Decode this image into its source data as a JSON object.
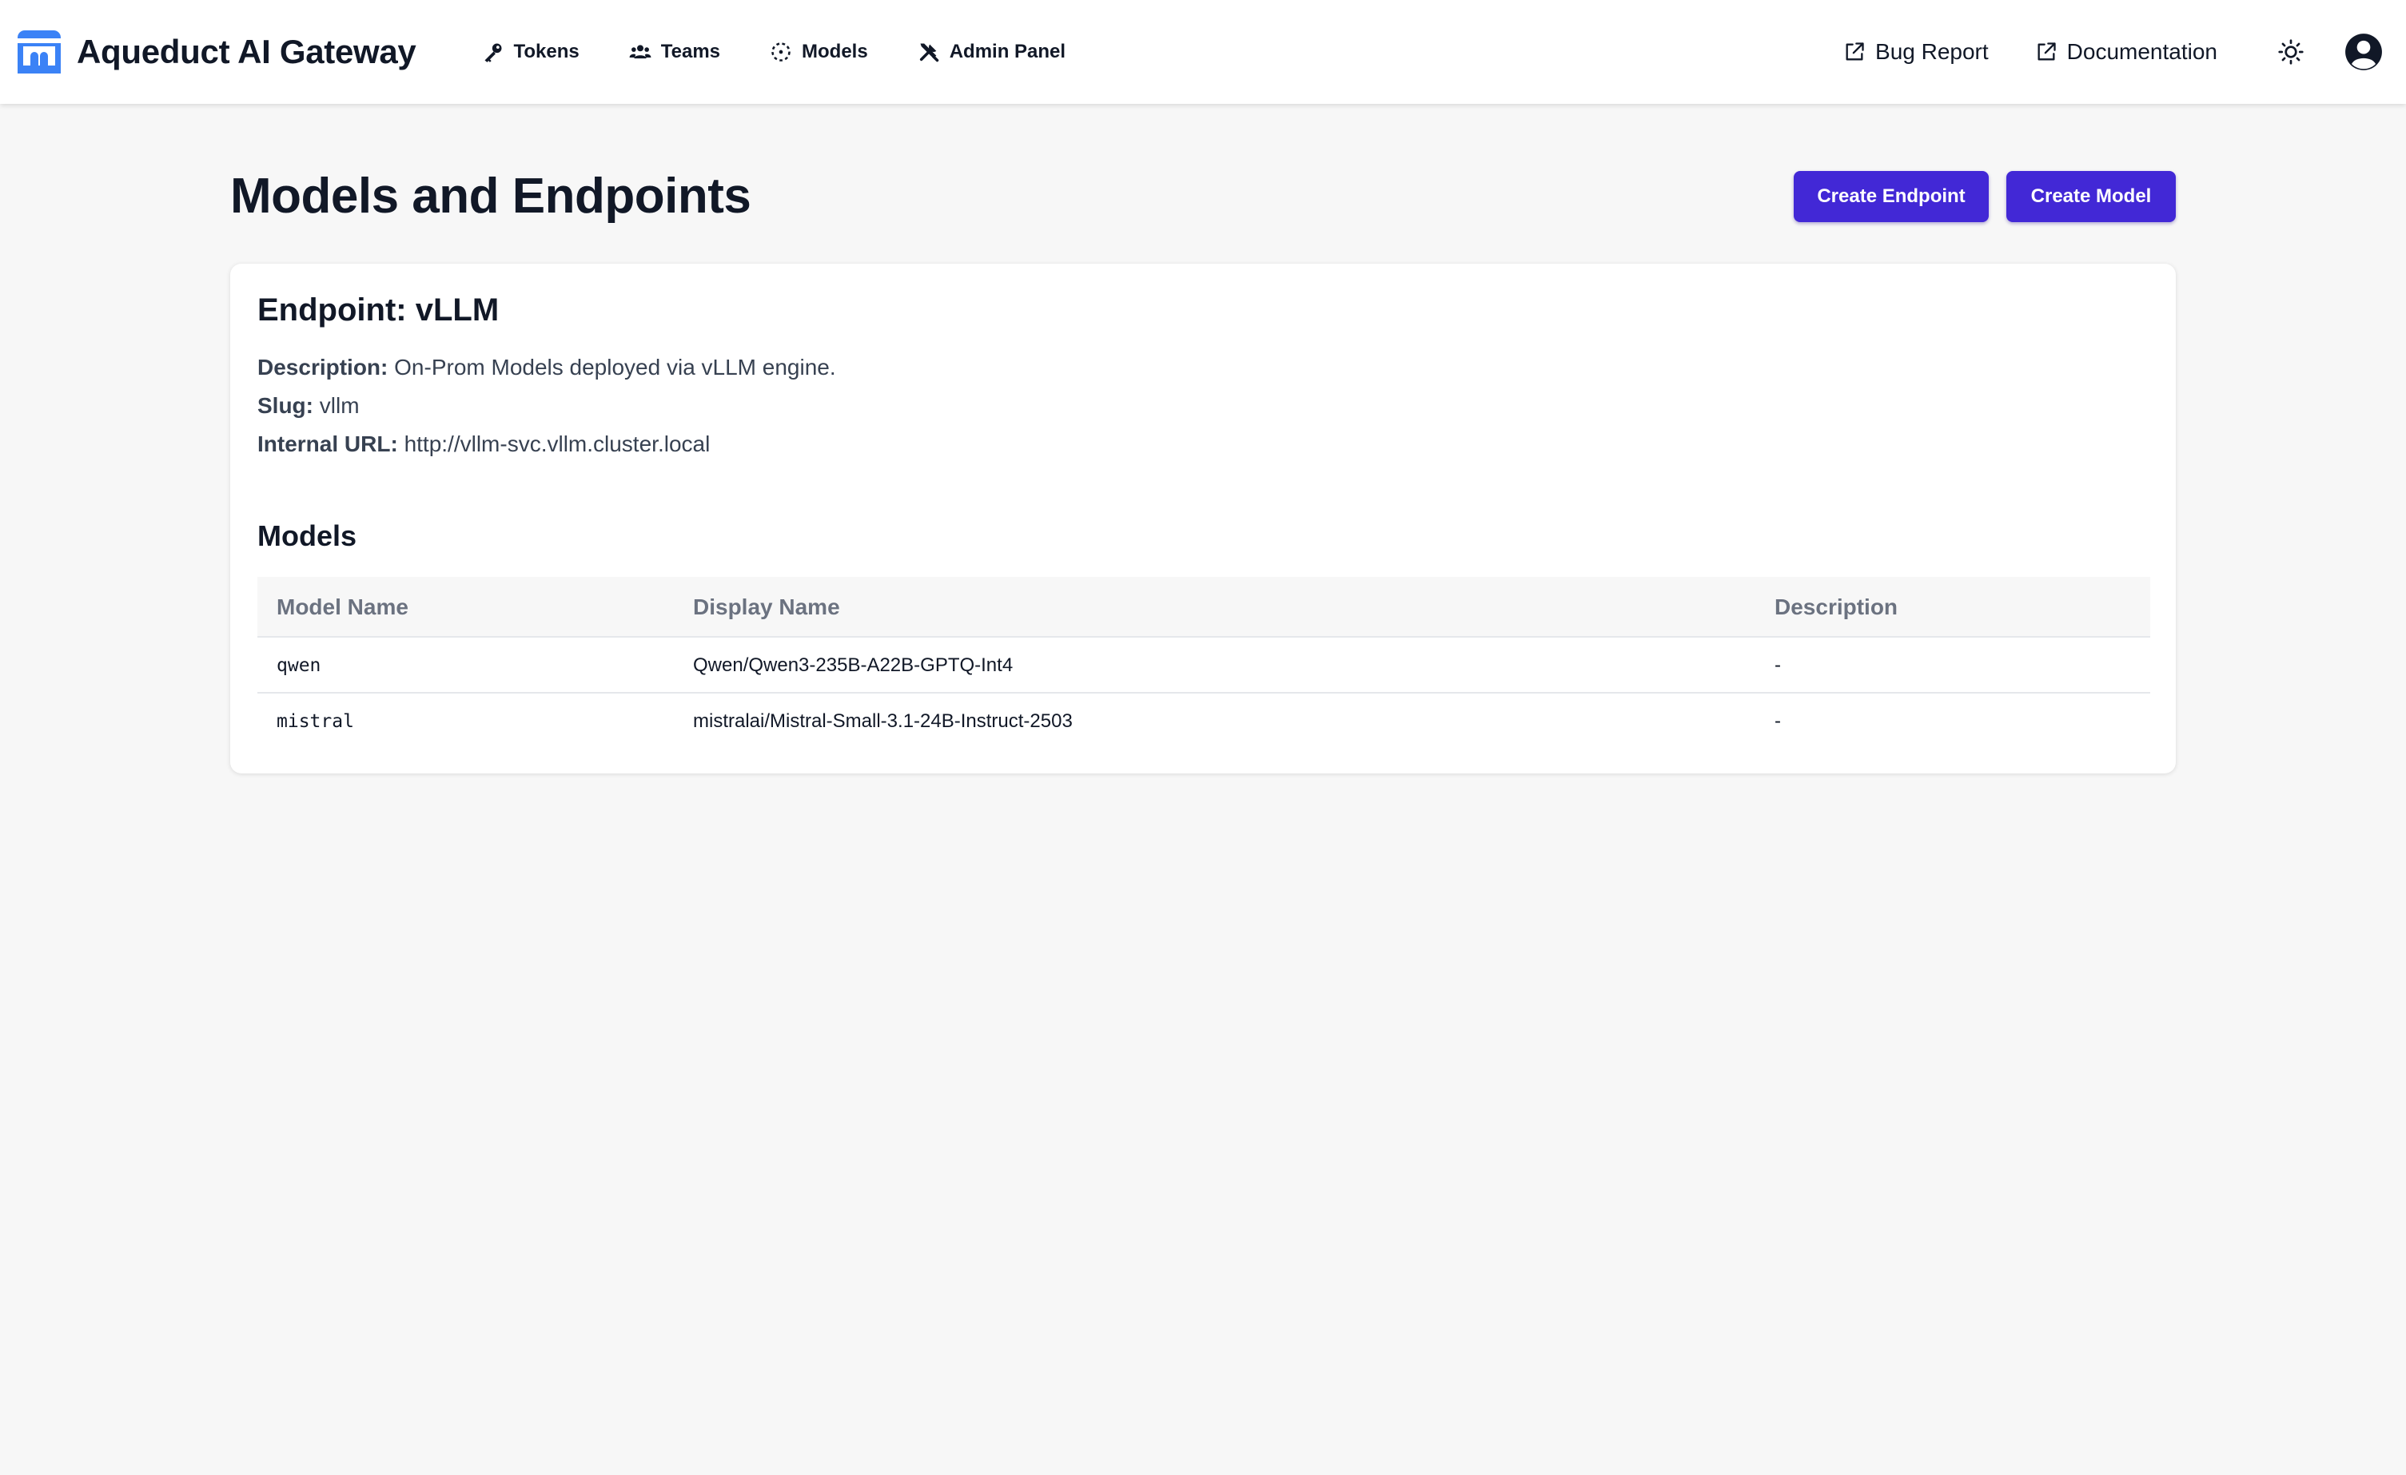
{
  "app": {
    "title": "Aqueduct AI Gateway",
    "accent_color": "#4228d6",
    "logo_color": "#3b82f6"
  },
  "nav": {
    "items": [
      {
        "label": "Tokens",
        "icon": "key-icon"
      },
      {
        "label": "Teams",
        "icon": "users-icon"
      },
      {
        "label": "Models",
        "icon": "models-icon"
      },
      {
        "label": "Admin Panel",
        "icon": "tools-icon"
      }
    ]
  },
  "header_right": {
    "bug_report": "Bug Report",
    "documentation": "Documentation",
    "theme_icon": "sun-icon",
    "avatar_icon": "user-circle-icon"
  },
  "page": {
    "title": "Models and Endpoints",
    "create_endpoint": "Create Endpoint",
    "create_model": "Create Model"
  },
  "endpoint": {
    "title": "Endpoint: vLLM",
    "description_label": "Description:",
    "description": "On-Prom Models deployed via vLLM engine.",
    "slug_label": "Slug:",
    "slug": "vllm",
    "url_label": "Internal URL:",
    "url": "http://vllm-svc.vllm.cluster.local"
  },
  "models": {
    "heading": "Models",
    "columns": [
      "Model Name",
      "Display Name",
      "Description"
    ],
    "rows": [
      {
        "name": "qwen",
        "display_name": "Qwen/Qwen3-235B-A22B-GPTQ-Int4",
        "description": "-"
      },
      {
        "name": "mistral",
        "display_name": "mistralai/Mistral-Small-3.1-24B-Instruct-2503",
        "description": "-"
      }
    ]
  }
}
